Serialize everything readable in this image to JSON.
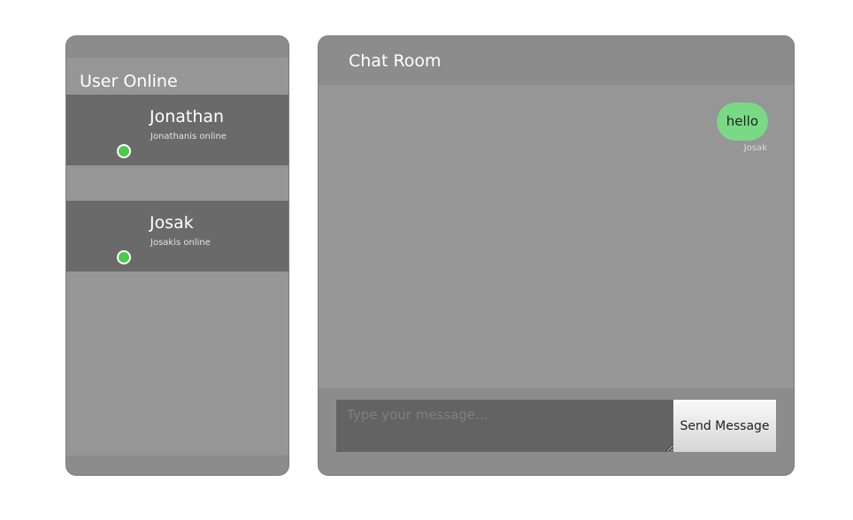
{
  "users_panel": {
    "title": "User Online",
    "users": [
      {
        "name": "Jonathan",
        "status": "Jonathanis online",
        "online": true
      },
      {
        "name": "Josak",
        "status": "Josakis online",
        "online": true
      }
    ]
  },
  "chat": {
    "title": "Chat Room",
    "messages": [
      {
        "text": "hello",
        "author": "Josak"
      }
    ],
    "input_placeholder": "Type your message...",
    "send_label": "Send Message"
  },
  "colors": {
    "online": "#4ccb4c",
    "own_message_bubble": "#78da85",
    "panel": "#8c8c8c",
    "user_card": "#6a6a6a",
    "message_input": "#636363"
  }
}
